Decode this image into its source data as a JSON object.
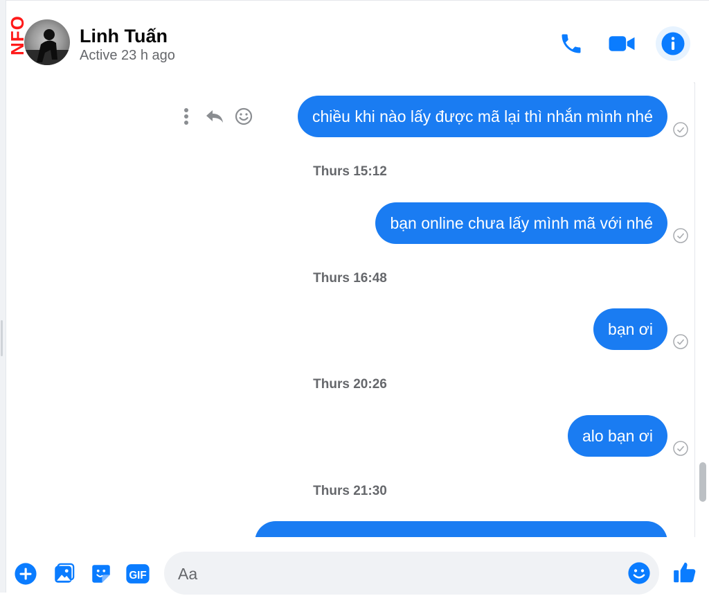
{
  "watermark": {
    "text": "NFO"
  },
  "header": {
    "contact_name": "Linh Tuấn",
    "status": "Active 23 h ago",
    "icons": [
      "phone-icon",
      "video-camera-icon",
      "info-icon"
    ]
  },
  "chat": {
    "messages": [
      {
        "text": "chiều khi nào lấy được mã lại thì nhắn mình nhé",
        "status": "sent"
      },
      {
        "time": "Thurs 15:12"
      },
      {
        "text": "bạn online chưa lấy mình mã với nhé",
        "status": "sent"
      },
      {
        "time": "Thurs 16:48"
      },
      {
        "text": "bạn ơi",
        "status": "sent"
      },
      {
        "time": "Thurs 20:26"
      },
      {
        "text": "alo bạn ơi",
        "status": "sent"
      },
      {
        "time": "Thurs 21:30"
      }
    ],
    "hover_actions": [
      "more-icon",
      "reply-icon",
      "react-icon"
    ]
  },
  "composer": {
    "placeholder": "Aa",
    "gif_label": "GIF",
    "icons": [
      "plus-icon",
      "image-icon",
      "sticker-icon",
      "gif-icon",
      "emoji-icon",
      "like-icon"
    ]
  },
  "colors": {
    "accent": "#0a7cff",
    "bubble": "#1a7cf2",
    "muted_text": "#65676b"
  }
}
